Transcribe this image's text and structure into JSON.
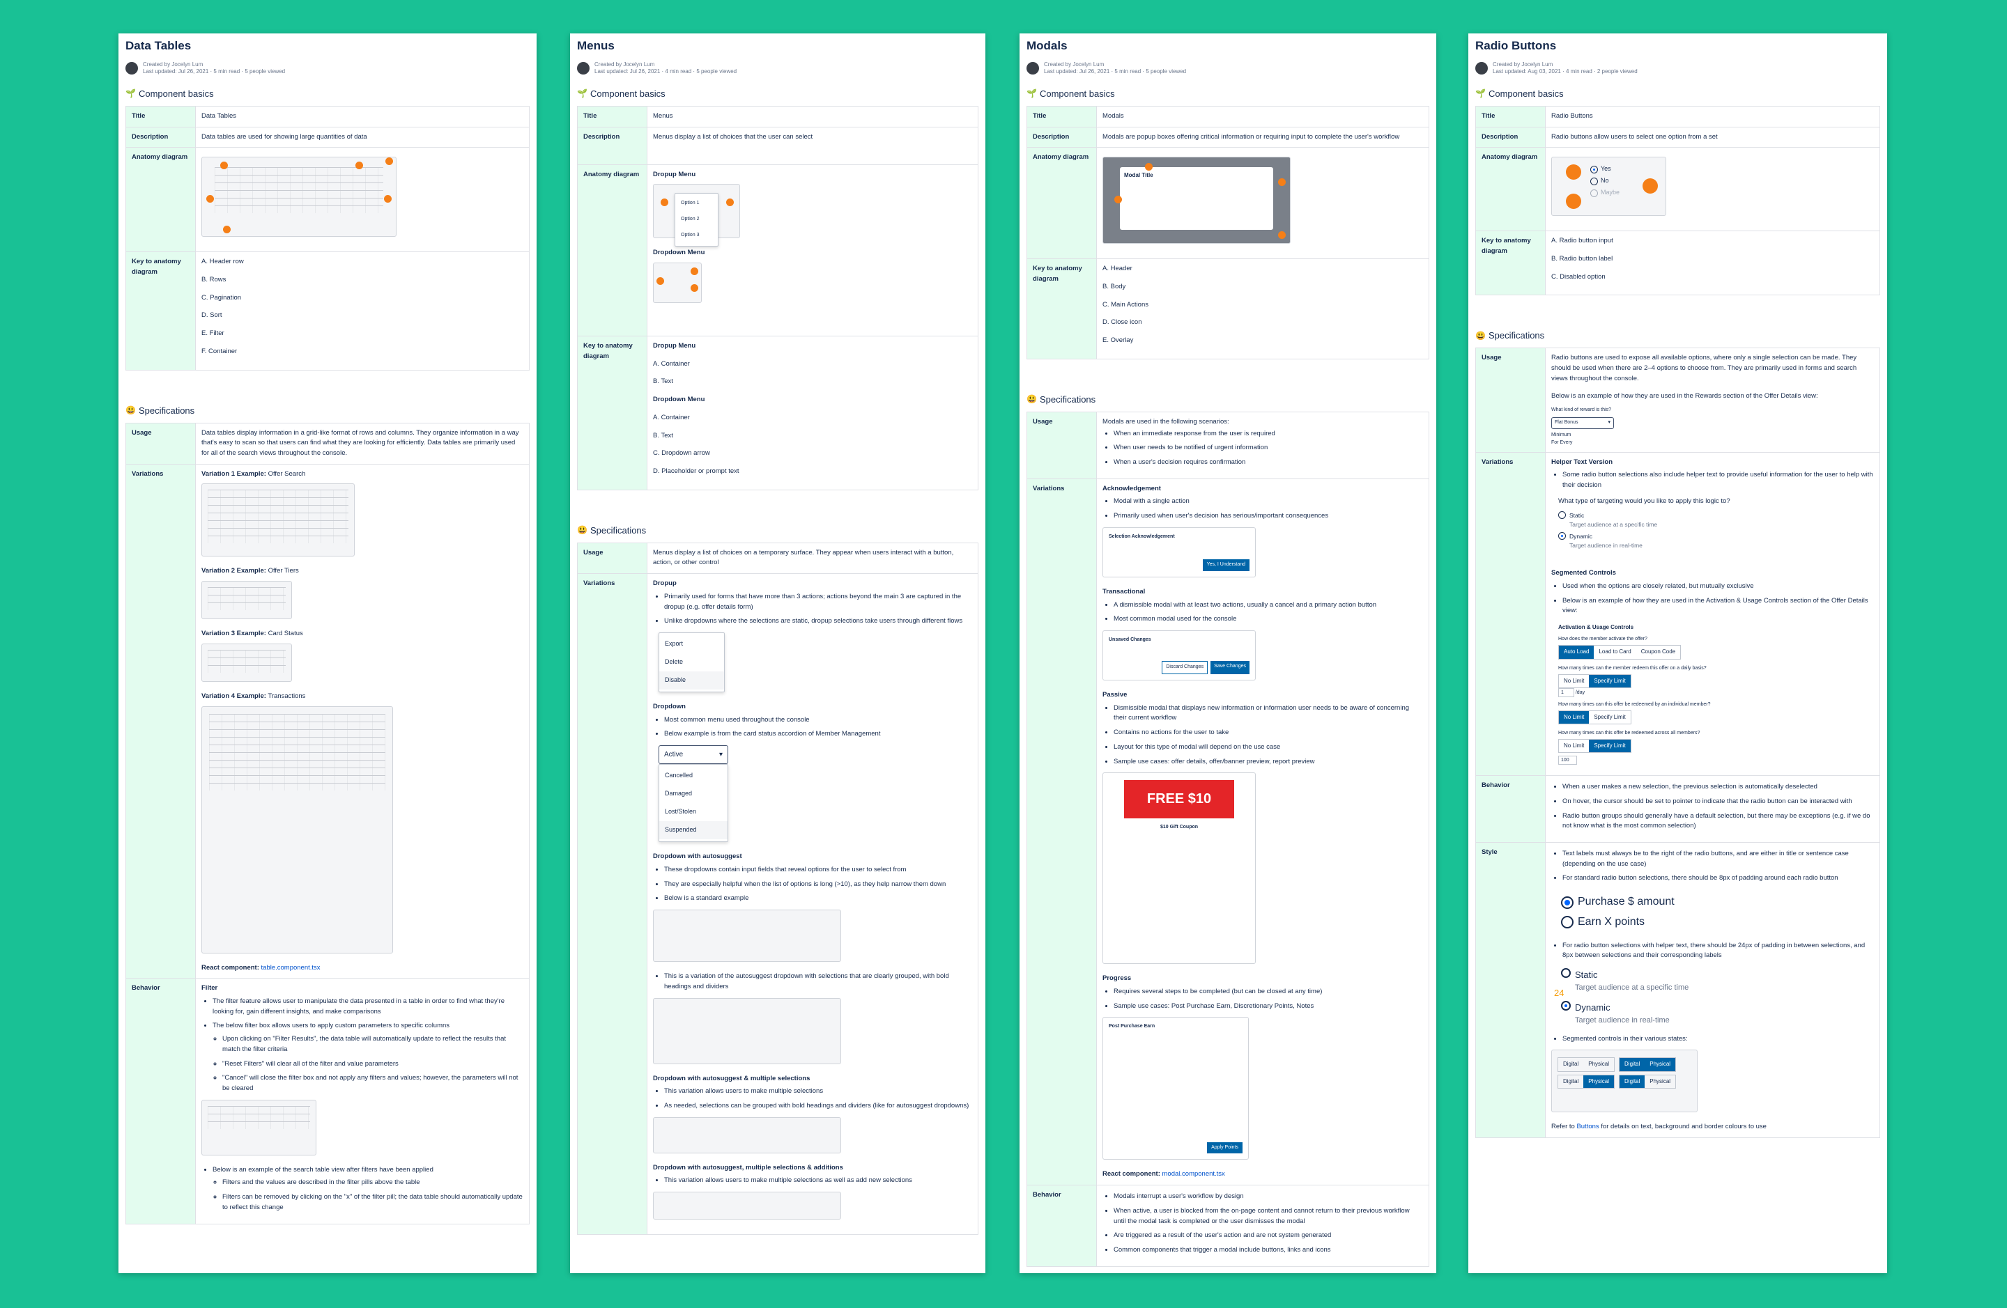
{
  "cards": [
    {
      "title": "Data Tables",
      "meta1": "Created by Jocelyn Lum",
      "meta2": "Last updated: Jul 26, 2021 · 5 min read · 5 people viewed",
      "section_basics": "Component basics",
      "rows": {
        "title_label": "Title",
        "title": "Data Tables",
        "desc_label": "Description",
        "desc": "Data tables are used for showing large quantities of data",
        "anatomy_label": "Anatomy diagram",
        "key_label": "Key to anatomy diagram",
        "keys": [
          "A. Header row",
          "B. Rows",
          "C. Pagination",
          "D. Sort",
          "E. Filter",
          "F. Container"
        ]
      },
      "section_specs": "Specifications",
      "usage_label": "Usage",
      "usage": "Data tables display information in a grid-like format of rows and columns. They organize information in a way that's easy to scan so that users can find what they are looking for efficiently. Data tables are primarily used for all of the search views throughout the console.",
      "variations_label": "Variations",
      "variations": [
        {
          "bold": "Variation 1 Example:",
          "text": " Offer Search"
        },
        {
          "bold": "Variation 2 Example:",
          "text": " Offer Tiers"
        },
        {
          "bold": "Variation 3 Example:",
          "text": " Card Status"
        },
        {
          "bold": "Variation 4 Example:",
          "text": " Transactions"
        }
      ],
      "react_label": "React component:",
      "react_link": "table.component.tsx",
      "behavior_label": "Behavior",
      "filter": "Filter",
      "behavior": [
        "The filter feature allows user to manipulate the data presented in a table in order to find what they're looking for, gain different insights, and make comparisons",
        "The below filter box allows users to apply custom parameters to specific columns"
      ],
      "behavior_sub": [
        "Upon clicking on \"Filter Results\", the data table will automatically update to reflect the results that match the filter criteria",
        "\"Reset Filters\" will clear all of the filter and value parameters",
        "\"Cancel\" will close the filter box and not apply any filters and values; however, the parameters will not be cleared"
      ],
      "behavior2": "Below is an example of the search table view after filters have been applied",
      "behavior2_sub": [
        "Filters and the values are described in the filter pills above the table",
        "Filters can be removed by clicking on the \"x\" of the filter pill; the data table should automatically update to reflect this change"
      ]
    },
    {
      "title": "Menus",
      "meta1": "Created by Jocelyn Lum",
      "meta2": "Last updated: Jul 26, 2021 · 4 min read · 5 people viewed",
      "section_basics": "Component basics",
      "rows": {
        "title_label": "Title",
        "title": "Menus",
        "desc_label": "Description",
        "desc": "Menus display a list of choices that the user can select",
        "anatomy_label": "Anatomy diagram",
        "key_label": "Key to anatomy diagram",
        "anatomy_a": "Dropup Menu",
        "anatomy_b": "Dropdown Menu",
        "options": [
          "Option 1",
          "Option 2",
          "Option 3"
        ],
        "key_groups": [
          {
            "head": "Dropup Menu",
            "items": [
              "A. Container",
              "B. Text"
            ]
          },
          {
            "head": "Dropdown Menu",
            "items": [
              "A. Container",
              "B. Text",
              "C. Dropdown arrow",
              "D. Placeholder or prompt text"
            ]
          }
        ]
      },
      "section_specs": "Specifications",
      "usage_label": "Usage",
      "usage": "Menus display a list of choices on a temporary surface. They appear when users interact with a button, action, or other control",
      "variations_label": "Variations",
      "dropup": "Dropup",
      "dropup_items": [
        "Primarily used for forms that have more than 3 actions; actions beyond the main 3 are captured in the dropup (e.g. offer details form)",
        "Unlike dropdowns where the selections are static, dropup selections take users through different flows"
      ],
      "dropup_menu": [
        "Export",
        "Delete",
        "Disable"
      ],
      "dropdown": "Dropdown",
      "dropdown_items": [
        "Most common menu used throughout the console",
        "Below example is from the card status accordion of Member Management"
      ],
      "dropdown_selected": "Active",
      "dropdown_options": [
        "Cancelled",
        "Damaged",
        "Lost/Stolen",
        "Suspended"
      ],
      "autosuggest": "Dropdown with autosuggest",
      "autosuggest_items": [
        "These dropdowns contain input fields that reveal options for the user to select from",
        "They are especially helpful when the list of options is long (>10), as they help narrow them down",
        "Below is a standard example"
      ],
      "autosuggest2": "This is a variation of the autosuggest dropdown with selections that are clearly grouped, with bold headings and dividers",
      "multi": "Dropdown with autosuggest & multiple selections",
      "multi_items": [
        "This variation allows users to make multiple selections",
        "As needed, selections can be grouped with bold headings and dividers (like for autosuggest dropdowns)"
      ],
      "multi_add": "Dropdown with autosuggest, multiple selections & additions",
      "multi_add_items": [
        "This variation allows users to make multiple selections as well as add new selections"
      ]
    },
    {
      "title": "Modals",
      "meta1": "Created by Jocelyn Lum",
      "meta2": "Last updated: Jul 26, 2021 · 5 min read · 5 people viewed",
      "section_basics": "Component basics",
      "rows": {
        "title_label": "Title",
        "title": "Modals",
        "desc_label": "Description",
        "desc": "Modals are popup boxes offering critical information or requiring input to complete the user's workflow",
        "anatomy_label": "Anatomy diagram",
        "key_label": "Key to anatomy diagram",
        "modal_title": "Modal Title",
        "keys": [
          "A. Header",
          "B. Body",
          "C. Main Actions",
          "D. Close icon",
          "E. Overlay"
        ]
      },
      "section_specs": "Specifications",
      "usage_label": "Usage",
      "usage": "Modals are used in the following scenarios:",
      "usage_items": [
        "When an immediate response from the user is required",
        "When user needs to be notified of urgent information",
        "When a user's decision requires confirmation"
      ],
      "variations_label": "Variations",
      "ack": "Acknowledgement",
      "ack_items": [
        "Modal with a single action",
        "Primarily used when user's decision has serious/important consequences"
      ],
      "ack_modal": "Selection Acknowledgement",
      "ack_btn": "Yes, I Understand",
      "trans": "Transactional",
      "trans_items": [
        "A dismissible modal with at least two actions, usually a cancel and a primary action button",
        "Most common modal used for the console"
      ],
      "trans_modal": "Unsaved Changes",
      "trans_btn1": "Discard Changes",
      "trans_btn2": "Save Changes",
      "passive": "Passive",
      "passive_items": [
        "Dismissible modal that displays new information or information user needs to be aware of concerning their current workflow",
        "Contains no actions for the user to take",
        "Layout for this type of modal will depend on the use case",
        "Sample use cases: offer details, offer/banner preview, report preview"
      ],
      "promo": "FREE $10",
      "promo_title": "$10 Gift Coupon",
      "progress": "Progress",
      "progress_items": [
        "Requires several steps to be completed (but can be closed at any time)",
        "Sample use cases: Post Purchase Earn, Discretionary Points, Notes"
      ],
      "ppe": "Post Purchase Earn",
      "ppe_btn": "Apply Points",
      "react_label": "React component:",
      "react_link": "modal.component.tsx",
      "behavior_label": "Behavior",
      "behavior": [
        "Modals interrupt a user's workflow by design",
        "When active, a user is blocked from the on-page content and cannot return to their previous workflow until the modal task is completed or the user dismisses the modal",
        "Are triggered as a result of the user's action and are not system generated",
        "Common components that trigger a modal include buttons, links and icons"
      ]
    },
    {
      "title": "Radio Buttons",
      "meta1": "Created by Jocelyn Lum",
      "meta2": "Last updated: Aug 03, 2021 · 4 min read · 2 people viewed",
      "section_basics": "Component basics",
      "rows": {
        "title_label": "Title",
        "title": "Radio Buttons",
        "desc_label": "Description",
        "desc": "Radio buttons allow users to select one option from a set",
        "anatomy_label": "Anatomy diagram",
        "key_label": "Key to anatomy diagram",
        "anatomy_opts": [
          "Yes",
          "No",
          "Maybe"
        ],
        "keys": [
          "A. Radio button input",
          "B. Radio button label",
          "C. Disabled option"
        ]
      },
      "section_specs": "Specifications",
      "usage_label": "Usage",
      "usage": "Radio buttons are used to expose all available options, where only a single selection can be made. They should be used when there are 2–4 options to choose from. They are primarily used in forms and search views throughout the console.",
      "usage2": "Below is an example of how they are used in the Rewards section of the Offer Details view:",
      "usage_q": "What kind of reward is this?",
      "usage_sel": "Flat Bonus",
      "usage_opts": [
        "Minimum",
        "For Every"
      ],
      "variations_label": "Variations",
      "helper": "Helper Text Version",
      "helper_items": [
        "Some radio button selections also include helper text to provide useful information for the user to help with their decision"
      ],
      "helper_q": "What type of targeting would you like to apply this logic to?",
      "helper_opts": [
        {
          "t": "Static",
          "s": "Target audience at a specific time"
        },
        {
          "t": "Dynamic",
          "s": "Target audience in real-time"
        }
      ],
      "seg": "Segmented Controls",
      "seg_items": [
        "Used when the options are closely related, but mutually exclusive",
        "Below is an example of how they are used in the Activation & Usage Controls section of the Offer Details view:"
      ],
      "seg_title": "Activation & Usage Controls",
      "seg_q1": "How does the member activate the offer?",
      "seg_opts1": [
        "Auto Load",
        "Load to Card",
        "Coupon Code"
      ],
      "seg_q2": "How many times can the member redeem this offer on a daily basis?",
      "seg_q3": "How many times can this offer be redeemed by an individual member?",
      "seg_q4": "How many times can this offer be redeemed across all members?",
      "seg_opts2": [
        "No Limit",
        "Specify Limit"
      ],
      "seg_val1": "1",
      "seg_unit": "/day",
      "seg_val2": "100",
      "behavior_label": "Behavior",
      "behavior": [
        "When a user makes a new selection, the previous selection is automatically deselected",
        "On hover, the cursor should be set to pointer to indicate that the radio button can be interacted with",
        "Radio button groups should generally have a default selection, but there may be exceptions (e.g. if we do not know what is the most common selection)"
      ],
      "style_label": "Style",
      "style_items": [
        "Text labels must always be to the right of the radio buttons, and are either in title or sentence case (depending on the use case)",
        "For standard radio button selections, there should be 8px of padding around each radio button"
      ],
      "style_opts": [
        "Purchase $ amount",
        "Earn X points"
      ],
      "style_items2": [
        "For radio button selections with helper text, there should be 24px of padding in between selections, and 8px between selections and their corresponding labels"
      ],
      "style_num": "24",
      "style_items3": [
        "Segmented controls in their various states:"
      ],
      "seg_states": [
        "Digital",
        "Physical"
      ],
      "refer_pre": "Refer to ",
      "refer_link": "Buttons",
      "refer_post": " for details on text, background and border colours to use"
    }
  ]
}
